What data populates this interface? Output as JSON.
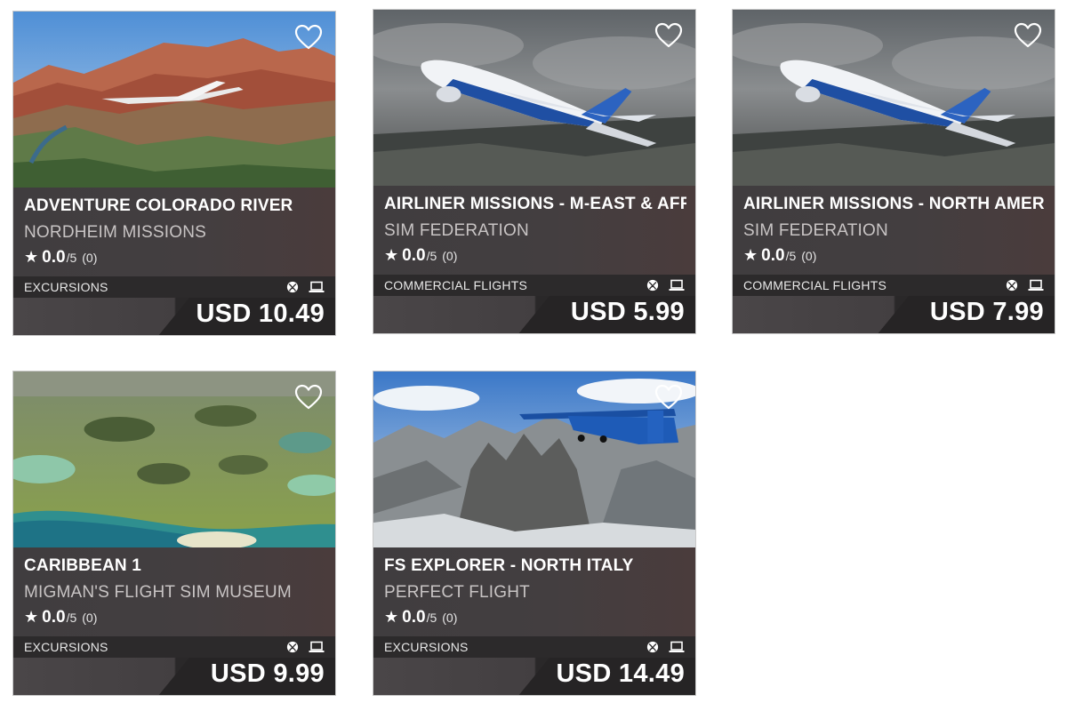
{
  "cards": [
    {
      "title": "ADVENTURE COLORADO RIVER",
      "publisher": "NORDHEIM MISSIONS",
      "rating": "0.0",
      "rating_max": "/5",
      "rating_count": "(0)",
      "category": "EXCURSIONS",
      "price": "USD 10.49",
      "image": "canyon-landscape-with-plane"
    },
    {
      "title": "AIRLINER MISSIONS - M-EAST & AFRICA",
      "publisher": "SIM FEDERATION",
      "rating": "0.0",
      "rating_max": "/5",
      "rating_count": "(0)",
      "category": "COMMERCIAL FLIGHTS",
      "price": "USD 5.99",
      "image": "boeing-airliner-over-clouds"
    },
    {
      "title": "AIRLINER MISSIONS - NORTH AMERICA",
      "publisher": "SIM FEDERATION",
      "rating": "0.0",
      "rating_max": "/5",
      "rating_count": "(0)",
      "category": "COMMERCIAL FLIGHTS",
      "price": "USD 7.99",
      "image": "boeing-airliner-over-clouds"
    },
    {
      "title": "CARIBBEAN 1",
      "publisher": "MIGMAN'S FLIGHT SIM MUSEUM",
      "rating": "0.0",
      "rating_max": "/5",
      "rating_count": "(0)",
      "category": "EXCURSIONS",
      "price": "USD 9.99",
      "image": "green-lagoons-aerial"
    },
    {
      "title": "FS EXPLORER - NORTH ITALY",
      "publisher": "PERFECT FLIGHT",
      "rating": "0.0",
      "rating_max": "/5",
      "rating_count": "(0)",
      "category": "EXCURSIONS",
      "price": "USD 14.49",
      "image": "bush-plane-over-dolomites"
    }
  ],
  "icons": {
    "favorite": "heart-outline-icon",
    "rating": "star-icon",
    "platform_xbox": "xbox-icon",
    "platform_pc": "laptop-icon"
  },
  "colors": {
    "card_info_bg": "#403d3f",
    "price_bar_dark": "#262425",
    "text_primary": "#ffffff",
    "text_secondary": "#c8c4c4"
  }
}
